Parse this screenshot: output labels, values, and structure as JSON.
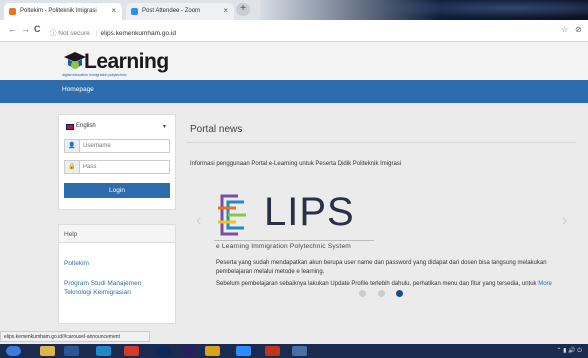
{
  "browser": {
    "tabs": [
      {
        "title": "Poltekim - Politeknik Imigrasi",
        "close": "×",
        "color": "#e8731a"
      },
      {
        "title": "Post Attendee - Zoom",
        "close": "×",
        "color": "#2d8cff"
      }
    ],
    "new_tab": "+",
    "nav": {
      "back": "←",
      "forward": "→",
      "reload": "C"
    },
    "url_info": "ⓘ Not secure",
    "url": "elips.kemenkumham.go.id",
    "star": "☆"
  },
  "site": {
    "logo_word": "Learning",
    "logo_tagline": "digital education immigration polytechnic",
    "nav_home": "Homepage"
  },
  "login": {
    "language": "English",
    "username_placeholder": "Username",
    "password_placeholder": "Pass",
    "login_label": "Login"
  },
  "help": {
    "heading": "Help",
    "links": [
      "Poltekim",
      "Program Studi Manajemen Teknologi Keimigrasian"
    ]
  },
  "news": {
    "title": "Portal news",
    "subtitle": "Informasi penggunaan Portal e-Learning untuk Peserta Didik Politeknik Imigrasi",
    "slide": {
      "logo_word": "LIPS",
      "logo_sub": "e Learning Immigration Polytechnic System",
      "para1": "Peserta yang sudah mendapatkan akun berupa user name dan password yang didapat dari dosen bisa langsung melakukan pembelajaran melalui metode e learning.",
      "para2": "Sebelum pembelajaran sebaiknya lakukan Update Profile terlebih dahulu, perhatikan menu dan fitur yang tersedia, untuk",
      "more": "More"
    },
    "dots": 3,
    "active_dot": 3
  },
  "status_bar": "elips.kemenkumham.go.id/#carousel-announcement",
  "taskbar": {
    "tray": "⌃ ▮ 🔊 ⏻"
  }
}
